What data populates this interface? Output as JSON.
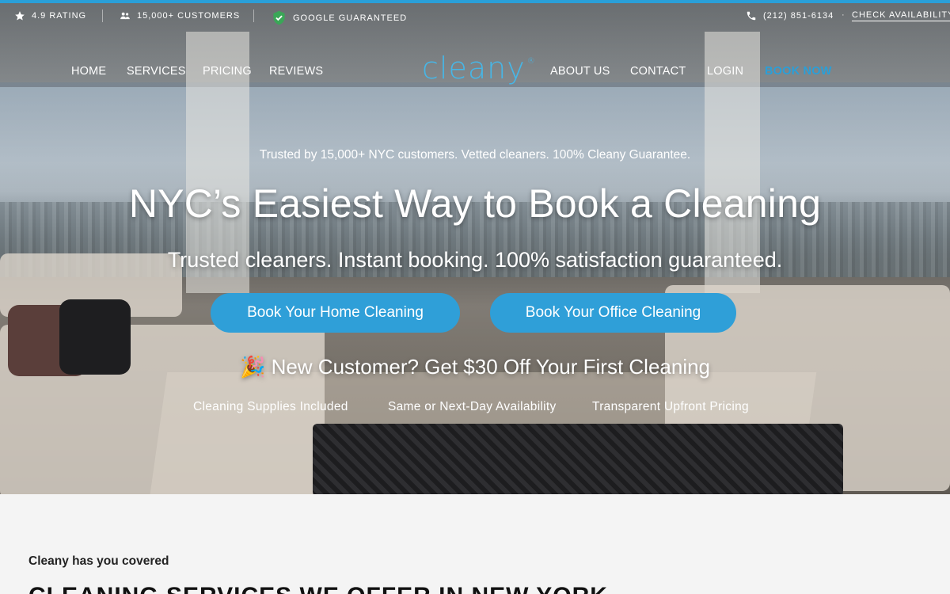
{
  "topbar": {
    "rating": "4.9 RATING",
    "customers": "15,000+ CUSTOMERS",
    "guarantee": "GOOGLE GUARANTEED",
    "phone": "(212) 851-6134",
    "check_availability": "CHECK AVAILABILITY"
  },
  "nav": {
    "left": [
      "HOME",
      "SERVICES",
      "PRICING",
      "REVIEWS"
    ],
    "logo": "cleany",
    "logo_mark": "®",
    "right": [
      "ABOUT US",
      "CONTACT",
      "LOGIN"
    ],
    "book_now": "BOOK NOW"
  },
  "hero": {
    "trusted": "Trusted by 15,000+ NYC customers. Vetted cleaners. 100% Cleany Guarantee.",
    "title": "NYC’s Easiest Way to Book a Cleaning",
    "subtitle": "Trusted cleaners. Instant booking. 100% satisfaction guaranteed.",
    "btn_home": "Book Your Home Cleaning",
    "btn_office": "Book Your Office Cleaning",
    "promo_emoji": "🎉",
    "promo": "New Customer? Get $30 Off Your First Cleaning",
    "features": [
      "Cleaning Supplies Included",
      "Same or Next-Day Availability",
      "Transparent Upfront Pricing"
    ]
  },
  "section": {
    "eyebrow": "Cleany has you covered",
    "title": "CLEANING SERVICES WE OFFER IN NEW YORK"
  },
  "colors": {
    "accent": "#2a9fd8",
    "logo": "#47b6e6",
    "guarantee_badge": "#3aa757"
  },
  "icons": [
    "star-icon",
    "users-icon",
    "shield-check-icon",
    "phone-icon"
  ]
}
